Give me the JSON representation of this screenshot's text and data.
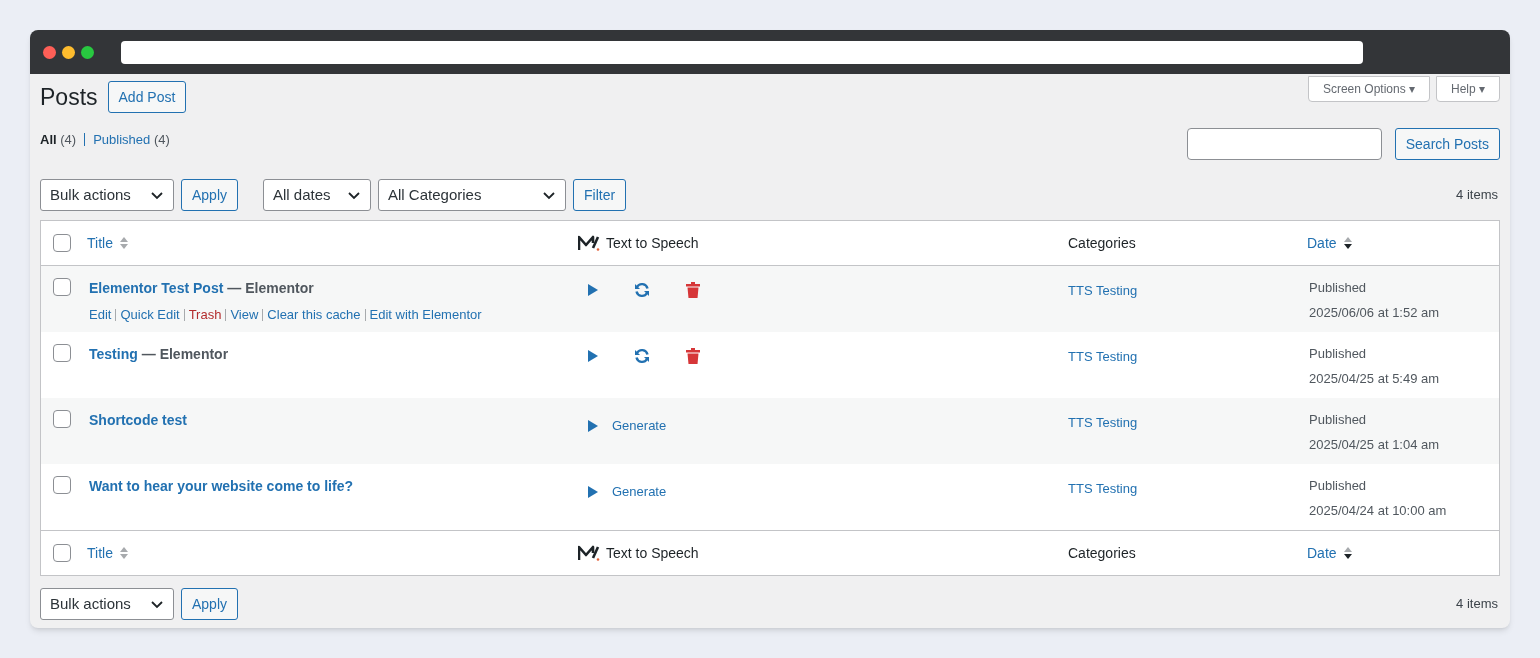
{
  "header": {
    "title": "Posts",
    "add_button": "Add Post",
    "screen_options": "Screen Options ▾",
    "help": "Help ▾"
  },
  "views": [
    {
      "label": "All",
      "count": "(4)",
      "selected": true
    },
    {
      "label": "Published",
      "count": "(4)",
      "selected": false
    }
  ],
  "search": {
    "button": "Search Posts"
  },
  "top_nav": {
    "bulk_actions": "Bulk actions",
    "apply": "Apply",
    "dates": "All dates",
    "categories": "All Categories",
    "filter": "Filter",
    "count": "4 items"
  },
  "table": {
    "header": {
      "select_all": {
        "checked": false
      },
      "columns": [
        {
          "label": "Title",
          "kind": "sortable",
          "sorted": false
        },
        {
          "label": "Text to Speech",
          "kind": "logo"
        },
        {
          "label": "Categories",
          "kind": "plain"
        },
        {
          "label": "Date",
          "kind": "sortable",
          "sorted": true
        }
      ]
    },
    "footer": {
      "select_all": {
        "checked": false
      },
      "columns": [
        {
          "label": "Title",
          "kind": "sortable",
          "sorted": false
        },
        {
          "label": "Text to Speech",
          "kind": "logo"
        },
        {
          "label": "Categories",
          "kind": "plain"
        },
        {
          "label": "Date",
          "kind": "sortable",
          "sorted": true
        }
      ]
    },
    "rows": [
      {
        "title": "Elementor Test Post",
        "state": "— Elementor",
        "checked": false,
        "actions": [
          {
            "label": "Edit",
            "kind": "link"
          },
          {
            "label": "Quick Edit",
            "kind": "link"
          },
          {
            "label": "Trash",
            "kind": "danger"
          },
          {
            "label": "View",
            "kind": "link"
          },
          {
            "label": "Clear this cache",
            "kind": "link"
          },
          {
            "label": "Edit with Elementor",
            "kind": "link"
          }
        ],
        "tts": {
          "kind": "controls"
        },
        "category": "TTS Testing",
        "status": "Published",
        "date": "2025/06/06 at 1:52 am"
      },
      {
        "title": "Testing",
        "state": "— Elementor",
        "checked": false,
        "tts": {
          "kind": "controls"
        },
        "category": "TTS Testing",
        "status": "Published",
        "date": "2025/04/25 at 5:49 am"
      },
      {
        "title": "Shortcode test",
        "checked": false,
        "tts": {
          "kind": "generate",
          "label": "Generate"
        },
        "category": "TTS Testing",
        "status": "Published",
        "date": "2025/04/25 at 1:04 am"
      },
      {
        "title": "Want to hear your website come to life?",
        "checked": false,
        "tts": {
          "kind": "generate",
          "label": "Generate"
        },
        "category": "TTS Testing",
        "status": "Published",
        "date": "2025/04/24 at 10:00 am"
      }
    ]
  },
  "bottom_nav": {
    "bulk_actions": "Bulk actions",
    "apply": "Apply",
    "count": "4 items"
  }
}
